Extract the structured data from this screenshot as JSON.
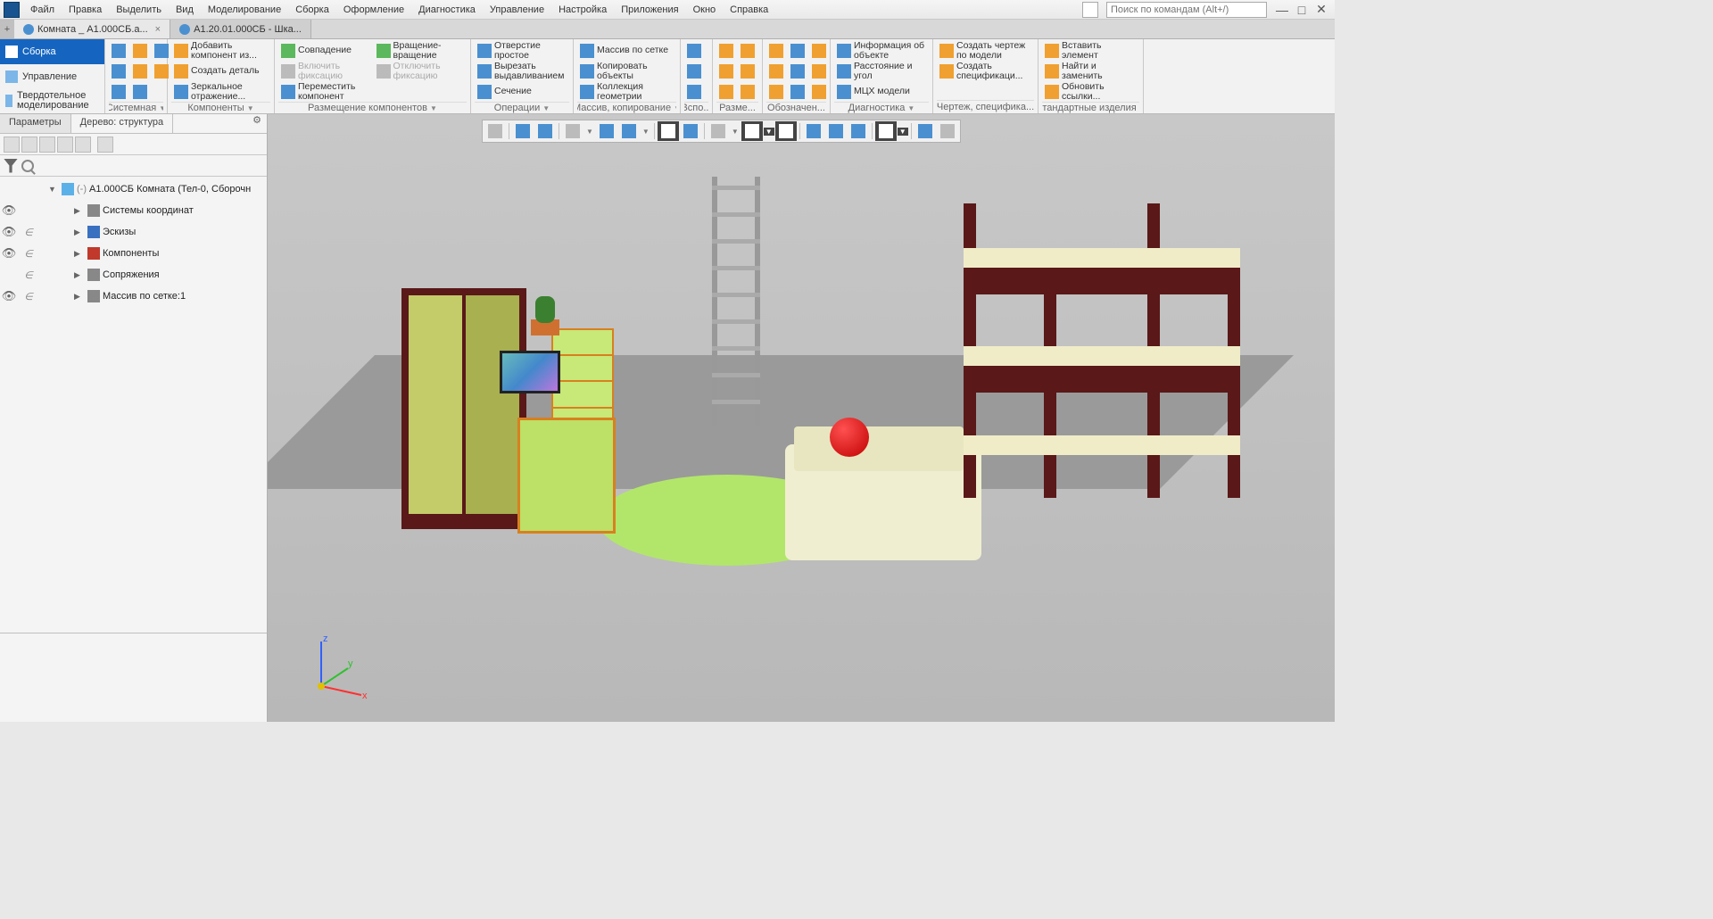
{
  "menu": {
    "items": [
      "Файл",
      "Правка",
      "Выделить",
      "Вид",
      "Моделирование",
      "Сборка",
      "Оформление",
      "Диагностика",
      "Управление",
      "Настройка",
      "Приложения",
      "Окно",
      "Справка"
    ],
    "search_placeholder": "Поиск по командам (Alt+/)"
  },
  "tabs": [
    {
      "label": "Комната _ А1.000СБ.а...",
      "active": true
    },
    {
      "label": "А1.20.01.000СБ - Шка...",
      "active": false
    }
  ],
  "side_modes": [
    {
      "label": "Сборка",
      "active": true
    },
    {
      "label": "Управление",
      "active": false
    },
    {
      "label": "Твердотельное моделирование",
      "active": false
    }
  ],
  "ribbon_groups": {
    "system": {
      "title": "Системная"
    },
    "components": {
      "title": "Компоненты",
      "add_from": "Добавить компонент из...",
      "create_part": "Создать деталь",
      "mirror": "Зеркальное отражение..."
    },
    "placement": {
      "title": "Размещение компонентов",
      "coincide": "Совпадение",
      "enable_fix": "Включить фиксацию",
      "move_comp": "Переместить компонент",
      "rotation": "Вращение-вращение",
      "disable_fix": "Отключить фиксацию"
    },
    "operations": {
      "title": "Операции",
      "hole": "Отверстие простое",
      "extrude_cut": "Вырезать выдавливанием",
      "section": "Сечение"
    },
    "array": {
      "title": "Массив, копирование",
      "grid_array": "Массив по сетке",
      "copy_obj": "Копировать объекты",
      "geom_coll": "Коллекция геометрии"
    },
    "aux": {
      "title": "Вспо..."
    },
    "dims": {
      "title": "Разме..."
    },
    "notes": {
      "title": "Обозначен..."
    },
    "diag": {
      "title": "Диагностика",
      "obj_info": "Информация об объекте",
      "dist_angle": "Расстояние и угол",
      "mcx": "МЦХ модели"
    },
    "drawing": {
      "title": "Чертеж, специфика...",
      "create_drw": "Создать чертеж по модели",
      "create_spec": "Создать спецификаци..."
    },
    "std": {
      "title": "Стандартные изделия",
      "insert_elem": "Вставить элемент",
      "find_replace": "Найти и заменить",
      "update_links": "Обновить ссылки..."
    }
  },
  "panel": {
    "tab_params": "Параметры",
    "tab_tree": "Дерево: структура"
  },
  "tree": {
    "root": "А1.000СБ Комната (Тел-0, Сборочн",
    "nodes": [
      {
        "label": "Системы координат",
        "vis": true,
        "inc": false
      },
      {
        "label": "Эскизы",
        "vis": true,
        "inc": true
      },
      {
        "label": "Компоненты",
        "vis": true,
        "inc": true
      },
      {
        "label": "Сопряжения",
        "vis": false,
        "inc": true
      },
      {
        "label": "Массив по сетке:1",
        "vis": true,
        "inc": true
      }
    ]
  },
  "axis": {
    "x": "x",
    "y": "y",
    "z": "z"
  }
}
